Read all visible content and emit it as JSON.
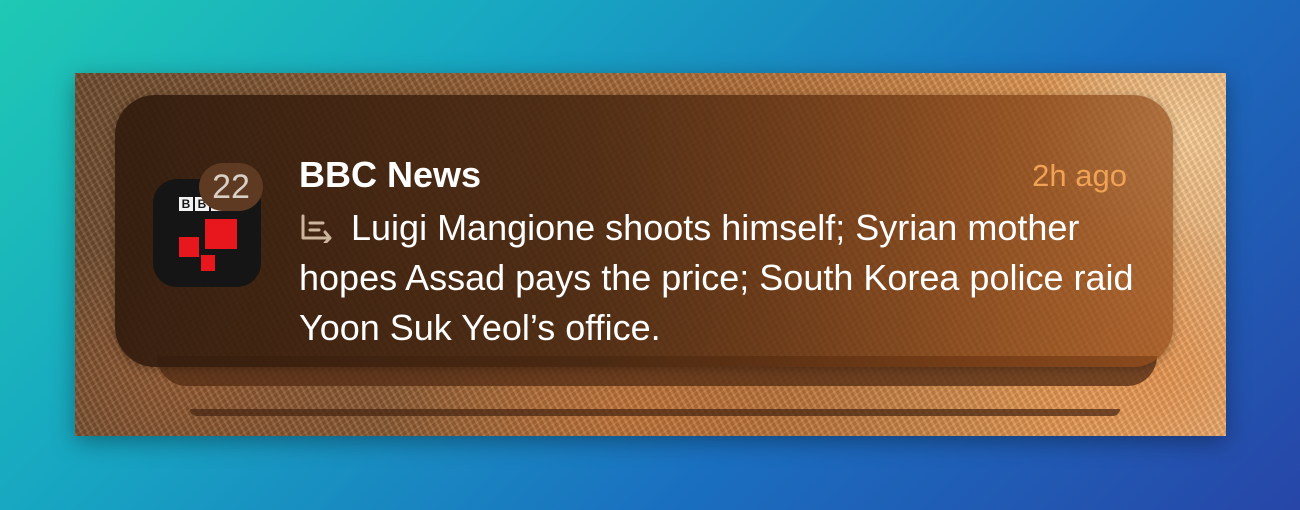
{
  "notification": {
    "app_name": "BBC News",
    "timestamp": "2h ago",
    "badge_count": "22",
    "summary_icon": "summary-lines-arrow-icon",
    "message": "Luigi Mangione shoots himself; Syrian mother hopes Assad pays the price; South Korea police raid Yoon Suk Yeol’s office."
  },
  "app_icon": {
    "logo_letters": [
      "B",
      "B",
      "C"
    ],
    "icon_name": "bbc-news-app-icon"
  },
  "colors": {
    "background_gradient_start": "#1fc9b4",
    "background_gradient_end": "#2746a8",
    "timestamp": "#f0a255",
    "icon_red": "#e8161d",
    "text": "#ffffff"
  }
}
